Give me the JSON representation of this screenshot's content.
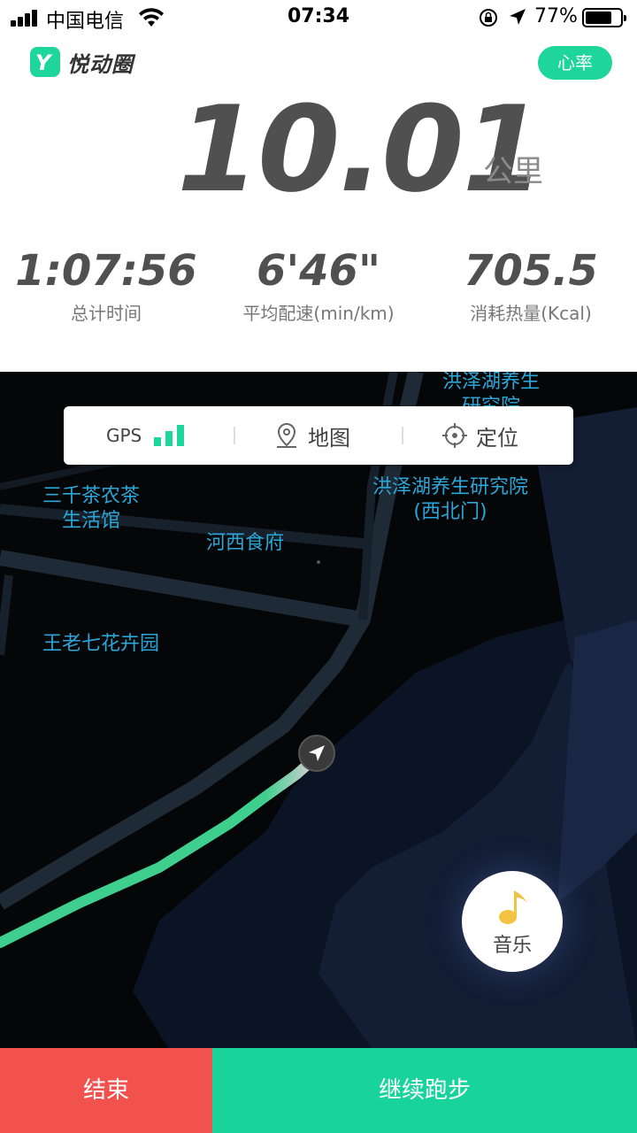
{
  "status_bar": {
    "carrier": "中国电信",
    "time": "07:34",
    "battery": "77%",
    "battery_level": 0.77
  },
  "header": {
    "app_name": "悦动圈",
    "heart_rate_label": "心率"
  },
  "run": {
    "distance": "10.01",
    "distance_unit": "公里",
    "stats": [
      {
        "value": "1:07:56",
        "label": "总计时间"
      },
      {
        "value": "6'46\"",
        "label": "平均配速(min/km)"
      },
      {
        "value": "705.5",
        "label": "消耗热量(Kcal)"
      }
    ]
  },
  "map": {
    "gps_label": "GPS",
    "gps_signal_bars": 3,
    "map_label": "地图",
    "locate_label": "定位",
    "places": [
      "洪泽湖养生研究院",
      "三千茶农茶生活馆",
      "洪泽湖养生研究院(西北门)",
      "河西食府",
      "王老七花卉园"
    ],
    "music_label": "音乐",
    "route_color": "#3ecf8e"
  },
  "actions": {
    "end_label": "结束",
    "continue_label": "继续跑步"
  },
  "colors": {
    "accent": "#1ed59a",
    "end": "#f2524e",
    "map_label": "#2aa7d8"
  }
}
